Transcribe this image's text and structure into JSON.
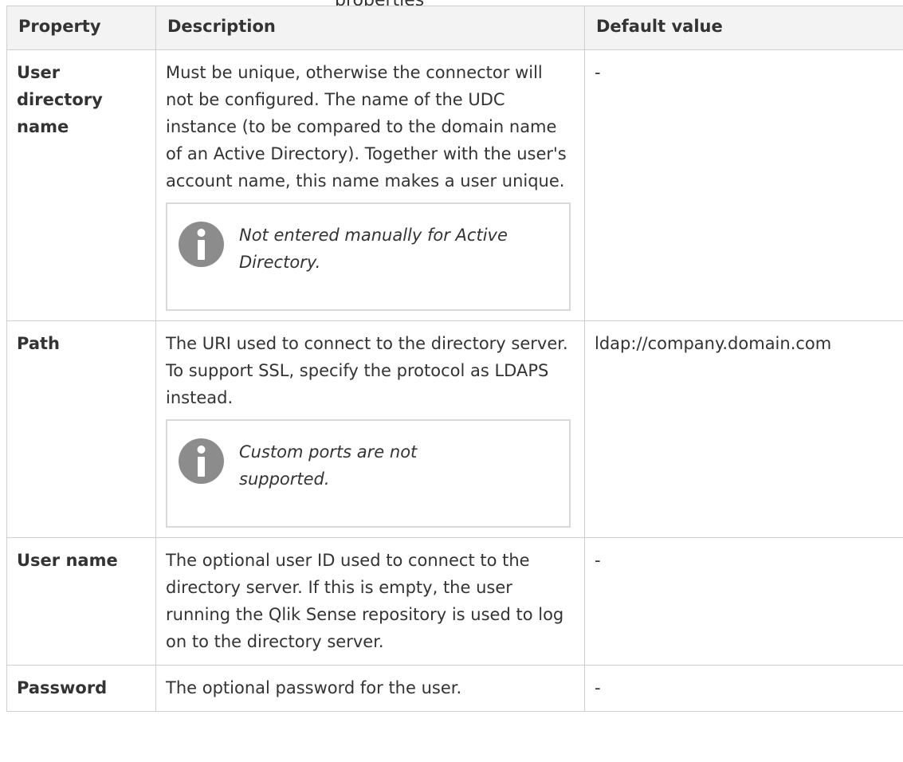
{
  "caption_fragment": "properties",
  "table": {
    "headers": {
      "property": "Property",
      "description": "Description",
      "default_value": "Default value"
    },
    "rows": [
      {
        "property": "User directory name",
        "description": "Must be unique, otherwise the connector will not be configured. The name of the UDC instance (to be compared to the domain name of an Active Directory). Together with the user's account name, this name makes a user unique.",
        "note": "Not entered manually for Active Directory.",
        "default": "-"
      },
      {
        "property": "Path",
        "description": "The URI used to connect to the directory server. To support SSL, specify the protocol as LDAPS instead.",
        "note": "Custom ports are not supported.",
        "default": "ldap://company.domain.com"
      },
      {
        "property": "User name",
        "description": "The optional user ID used to connect to the directory server. If this is empty, the user running the Qlik Sense repository is used to log on to the directory server.",
        "default": "-"
      },
      {
        "property": "Password",
        "description": "The optional password for the user.",
        "default": "-"
      }
    ]
  },
  "icons": {
    "note_icon": "info-icon",
    "note_icon_color": "#8c8c8c"
  },
  "colors": {
    "header_background": "#f3f3f3",
    "border": "#cfcfcf",
    "note_border": "#d9d9d9",
    "text": "#333333"
  }
}
